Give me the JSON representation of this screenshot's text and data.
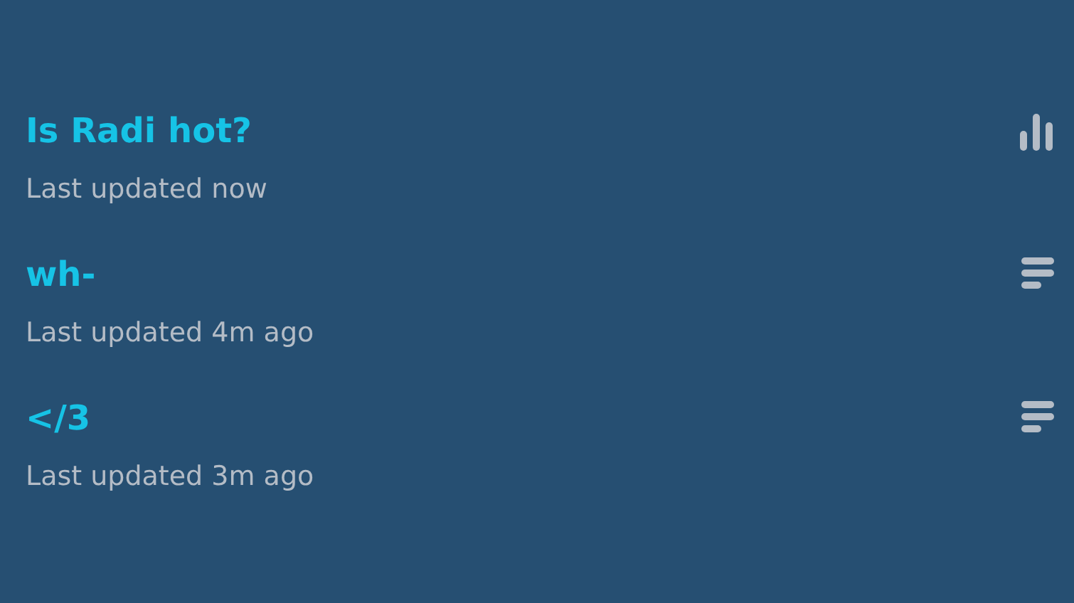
{
  "items": [
    {
      "title": "Is Radi hot?",
      "subtitle": "Last updated now",
      "kind": "poll"
    },
    {
      "title": "wh-",
      "subtitle": "Last updated 4m ago",
      "kind": "text"
    },
    {
      "title": "</3",
      "subtitle": "Last updated 3m ago",
      "kind": "text"
    }
  ]
}
